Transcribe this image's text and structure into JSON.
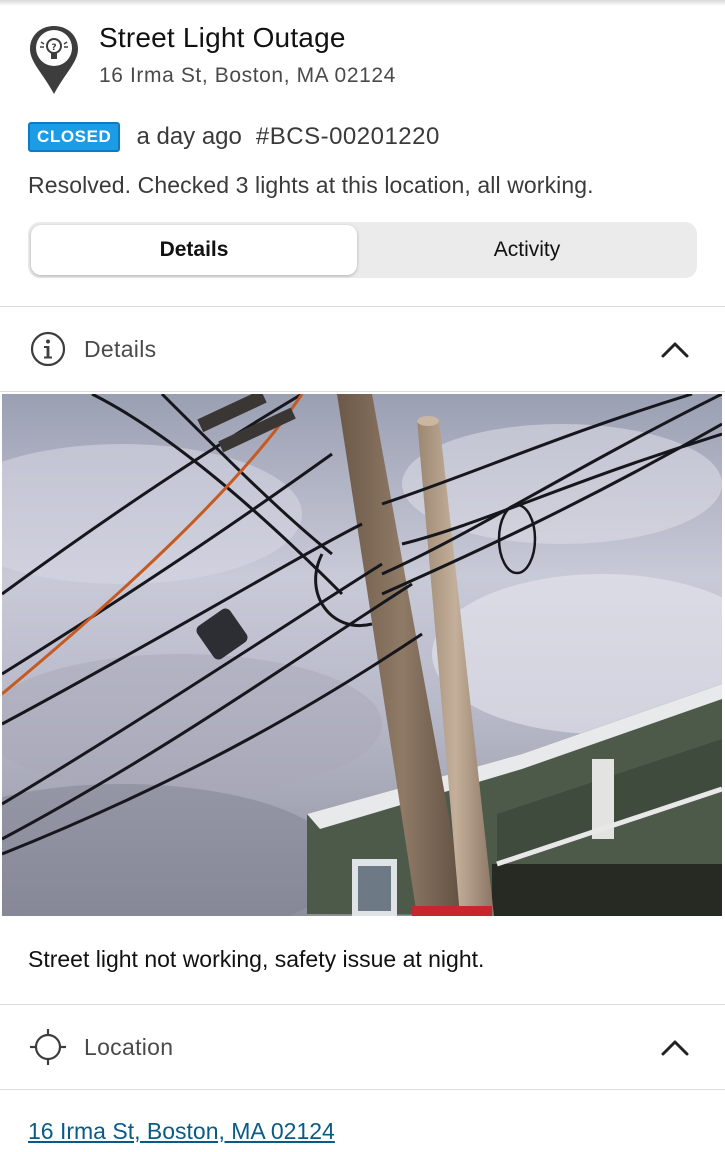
{
  "header": {
    "icon": "streetlight-pin-icon",
    "title": "Street Light Outage",
    "address": "16 Irma St, Boston, MA 02124"
  },
  "status": {
    "badge": "CLOSED",
    "badge_color": "#1c9ce5",
    "time_ago": "a day ago",
    "ticket_id": "#BCS-00201220"
  },
  "resolution_note": "Resolved. Checked 3 lights at this location, all working.",
  "tabs": [
    {
      "label": "Details",
      "active": true
    },
    {
      "label": "Activity",
      "active": false
    }
  ],
  "details_section": {
    "icon": "info-icon",
    "label": "Details",
    "toggle_icon": "chevron-up-icon",
    "photo": "photo of utility pole with wires against cloudy sky",
    "description": "Street light not working, safety issue at night."
  },
  "location_section": {
    "icon": "crosshair-icon",
    "label": "Location",
    "toggle_icon": "chevron-up-icon",
    "address_link": "16 Irma St, Boston, MA 02124"
  }
}
